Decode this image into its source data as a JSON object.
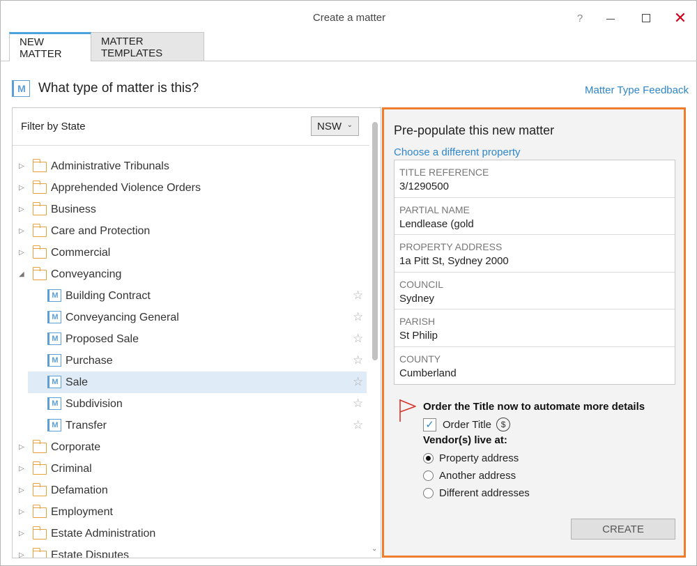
{
  "window": {
    "title": "Create a matter",
    "help": "?"
  },
  "tabs": [
    {
      "label": "NEW MATTER",
      "active": true
    },
    {
      "label": "MATTER TEMPLATES",
      "active": false
    }
  ],
  "heading": {
    "title": "What type of matter is this?",
    "feedback_link": "Matter Type Feedback"
  },
  "filter": {
    "label": "Filter by State",
    "state": "NSW"
  },
  "tree": [
    {
      "label": "Administrative Tribunals",
      "type": "folder",
      "expanded": false
    },
    {
      "label": "Apprehended Violence Orders",
      "type": "folder",
      "expanded": false
    },
    {
      "label": "Business",
      "type": "folder",
      "expanded": false
    },
    {
      "label": "Care and Protection",
      "type": "folder",
      "expanded": false
    },
    {
      "label": "Commercial",
      "type": "folder",
      "expanded": false
    },
    {
      "label": "Conveyancing",
      "type": "folder",
      "expanded": true
    },
    {
      "label": "Building Contract",
      "type": "matter"
    },
    {
      "label": "Conveyancing General",
      "type": "matter"
    },
    {
      "label": "Proposed Sale",
      "type": "matter"
    },
    {
      "label": "Purchase",
      "type": "matter"
    },
    {
      "label": "Sale",
      "type": "matter",
      "selected": true
    },
    {
      "label": "Subdivision",
      "type": "matter"
    },
    {
      "label": "Transfer",
      "type": "matter"
    },
    {
      "label": "Corporate",
      "type": "folder",
      "expanded": false
    },
    {
      "label": "Criminal",
      "type": "folder",
      "expanded": false
    },
    {
      "label": "Defamation",
      "type": "folder",
      "expanded": false
    },
    {
      "label": "Employment",
      "type": "folder",
      "expanded": false
    },
    {
      "label": "Estate Administration",
      "type": "folder",
      "expanded": false
    },
    {
      "label": "Estate Disputes",
      "type": "folder",
      "expanded": false
    }
  ],
  "prepopulate": {
    "title": "Pre-populate this new matter",
    "link": "Choose a different property",
    "properties": [
      {
        "label": "TITLE REFERENCE",
        "value": "3/1290500"
      },
      {
        "label": "PARTIAL NAME",
        "value": "Lendlease (gold"
      },
      {
        "label": "PROPERTY ADDRESS",
        "value": "1a Pitt St, Sydney 2000"
      },
      {
        "label": "COUNCIL",
        "value": "Sydney"
      },
      {
        "label": "PARISH",
        "value": "St Philip"
      },
      {
        "label": "COUNTY",
        "value": "Cumberland"
      }
    ],
    "order_title_heading": "Order the Title now to automate more details",
    "order_title_label": "Order Title",
    "order_title_checked": true,
    "vendor_label": "Vendor(s) live at:",
    "vendor_options": [
      {
        "label": "Property address",
        "checked": true
      },
      {
        "label": "Another address",
        "checked": false
      },
      {
        "label": "Different addresses",
        "checked": false
      }
    ],
    "create_label": "CREATE"
  },
  "icons": {
    "matter_icon_letter": "M",
    "dollar": "$",
    "check": "✓",
    "star": "☆",
    "collapsed": "▷",
    "expanded": "◢",
    "close": "✕"
  },
  "colors": {
    "accent_blue": "#2f86c9",
    "highlight_orange": "#ef7d2e",
    "folder_orange": "#e9a23b",
    "flag_red": "#d9342b",
    "close_red": "#d0021b",
    "selected_row": "#dfebf7"
  }
}
